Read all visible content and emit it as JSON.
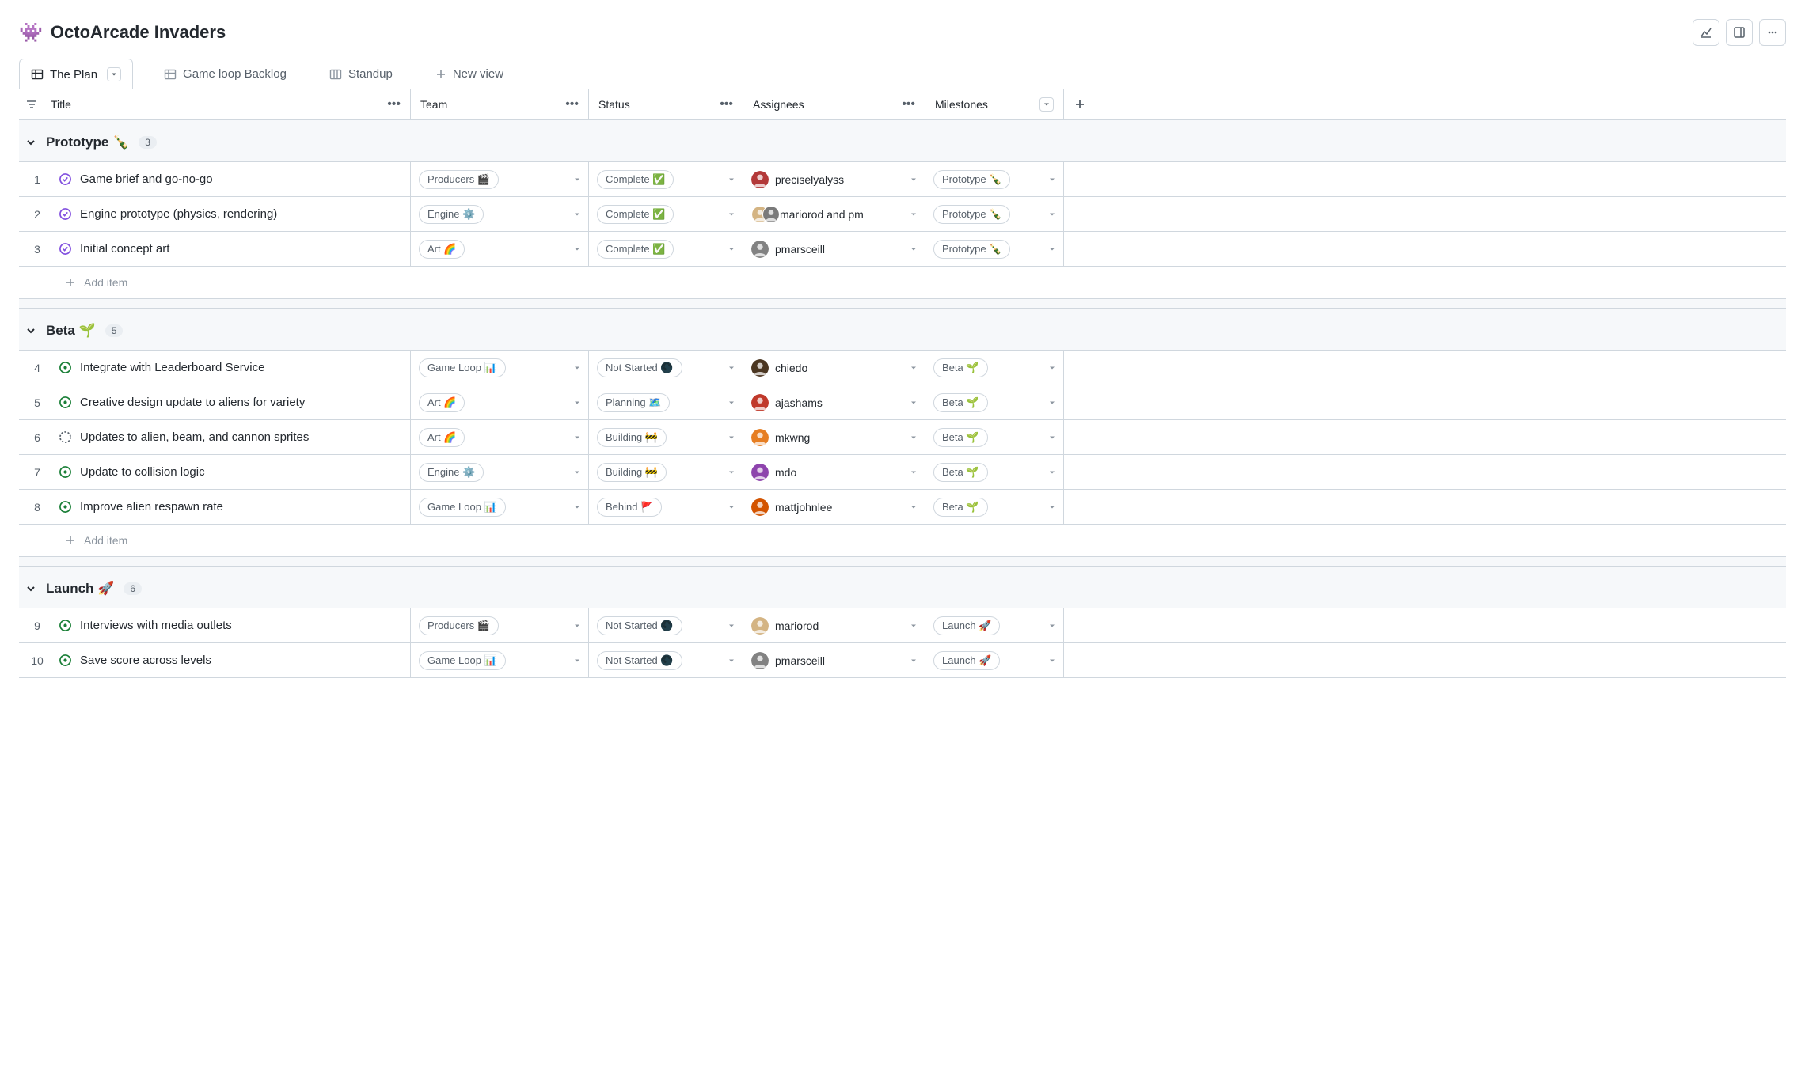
{
  "header": {
    "emoji": "👾",
    "title": "OctoArcade Invaders"
  },
  "tabs": {
    "active": "The Plan",
    "items": [
      "The Plan",
      "Game loop Backlog",
      "Standup"
    ],
    "newViewLabel": "New view"
  },
  "columns": {
    "title": "Title",
    "team": "Team",
    "status": "Status",
    "assignees": "Assignees",
    "milestones": "Milestones"
  },
  "addItemLabel": "Add item",
  "groups": [
    {
      "name": "Prototype",
      "emoji": "🍾",
      "count": "3",
      "rows": [
        {
          "num": "1",
          "icon": "closed",
          "title": "Game brief and go-no-go",
          "team": "Producers 🎬",
          "status": "Complete ✅",
          "assignees": {
            "avatars": [
              "#b33939"
            ],
            "text": "preciselyalyss"
          },
          "milestone": "Prototype 🍾"
        },
        {
          "num": "2",
          "icon": "closed",
          "title": "Engine prototype (physics, rendering)",
          "team": "Engine ⚙️",
          "status": "Complete ✅",
          "assignees": {
            "avatars": [
              "#d4b483",
              "#7a7a7a"
            ],
            "text": "mariorod and pm"
          },
          "milestone": "Prototype 🍾"
        },
        {
          "num": "3",
          "icon": "closed",
          "title": "Initial concept art",
          "team": "Art 🌈",
          "status": "Complete ✅",
          "assignees": {
            "avatars": [
              "#828282"
            ],
            "text": "pmarsceill"
          },
          "milestone": "Prototype 🍾"
        }
      ]
    },
    {
      "name": "Beta",
      "emoji": "🌱",
      "count": "5",
      "rows": [
        {
          "num": "4",
          "icon": "open",
          "title": "Integrate with Leaderboard Service",
          "team": "Game Loop 📊",
          "status": "Not Started 🌑",
          "assignees": {
            "avatars": [
              "#4b3621"
            ],
            "text": "chiedo"
          },
          "milestone": "Beta 🌱"
        },
        {
          "num": "5",
          "icon": "open",
          "title": "Creative design update to aliens for variety",
          "team": "Art 🌈",
          "status": "Planning 🗺️",
          "assignees": {
            "avatars": [
              "#c0392b"
            ],
            "text": "ajashams"
          },
          "milestone": "Beta 🌱"
        },
        {
          "num": "6",
          "icon": "draft",
          "title": "Updates to alien, beam, and cannon sprites",
          "team": "Art 🌈",
          "status": "Building 🚧",
          "assignees": {
            "avatars": [
              "#e67e22"
            ],
            "text": "mkwng"
          },
          "milestone": "Beta 🌱"
        },
        {
          "num": "7",
          "icon": "open",
          "title": "Update to collision logic",
          "team": "Engine ⚙️",
          "status": "Building 🚧",
          "assignees": {
            "avatars": [
              "#8e44ad"
            ],
            "text": "mdo"
          },
          "milestone": "Beta 🌱"
        },
        {
          "num": "8",
          "icon": "open",
          "title": "Improve alien respawn rate",
          "team": "Game Loop 📊",
          "status": "Behind 🚩",
          "assignees": {
            "avatars": [
              "#d35400"
            ],
            "text": "mattjohnlee"
          },
          "milestone": "Beta 🌱"
        }
      ]
    },
    {
      "name": "Launch",
      "emoji": "🚀",
      "count": "6",
      "rows": [
        {
          "num": "9",
          "icon": "open",
          "title": "Interviews with media outlets",
          "team": "Producers 🎬",
          "status": "Not Started 🌑",
          "assignees": {
            "avatars": [
              "#d4b483"
            ],
            "text": "mariorod"
          },
          "milestone": "Launch 🚀"
        },
        {
          "num": "10",
          "icon": "open",
          "title": "Save score across levels",
          "team": "Game Loop 📊",
          "status": "Not Started 🌑",
          "assignees": {
            "avatars": [
              "#828282"
            ],
            "text": "pmarsceill"
          },
          "milestone": "Launch 🚀"
        }
      ]
    }
  ]
}
